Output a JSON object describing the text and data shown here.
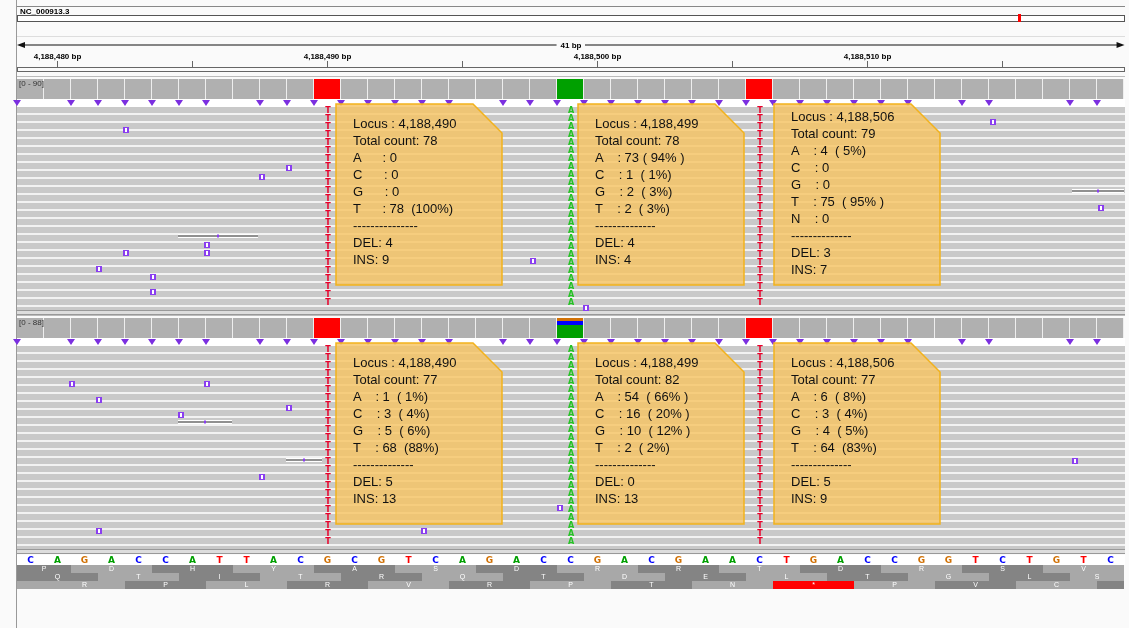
{
  "chromosome": {
    "name": "NC_000913.3"
  },
  "ruler": {
    "span": "41 bp",
    "ticks": [
      "4,188,480 bp",
      "4,188,490 bp",
      "4,188,500 bp",
      "4,188,510 bp"
    ]
  },
  "panels": [
    {
      "range": "[0 - 90]",
      "mismatches": [
        {
          "letters": "TTTTTTTTTTTTTTTTTTTTTTTTT",
          "color": "#e8002a",
          "alleles": [
            {
              "color": "#ff0000"
            }
          ]
        },
        {
          "letters": "AAAAAAAAAAAAAAAAAAAAAAAAA",
          "color": "#22c322",
          "alleles": [
            {
              "color": "#00a000"
            }
          ]
        },
        {
          "letters": "TTTTTTTTTTTTTTTTTTTTTTTTT",
          "color": "#e8002a",
          "alleles": [
            {
              "color": "#ff0000"
            }
          ]
        }
      ],
      "tooltips": [
        {
          "lines": [
            "Locus : 4,188,490",
            "Total count: 78",
            "A      : 0",
            "C      : 0",
            "G      : 0",
            "T      : 78  (100%)",
            "---------------",
            "DEL: 4",
            "INS: 9"
          ]
        },
        {
          "lines": [
            "Locus : 4,188,499",
            "Total count: 78",
            "A    : 73 ( 94% )",
            "C    : 1  ( 1%)",
            "G    : 2  ( 3%)",
            "T    : 2  ( 3%)",
            "--------------",
            "DEL: 4",
            "INS: 4"
          ]
        },
        {
          "lines": [
            "Locus : 4,188,506",
            "Total count: 79",
            "A    : 4  ( 5%)",
            "C    : 0",
            "G    : 0",
            "T    : 75  ( 95% )",
            "N    : 0",
            "--------------",
            "DEL: 3",
            "INS: 7"
          ]
        }
      ]
    },
    {
      "range": "[0 - 88]",
      "mismatches": [
        {
          "letters": "TTTTTTTTTTTTTTTTTTTTTTTTT",
          "color": "#e8002a",
          "alleles": [
            {
              "color": "#ff0000"
            }
          ]
        },
        {
          "letters": "AAAAAAAAAAAAAAAAAAAAAAAAA",
          "color": "#22c322",
          "alleles": [
            {
              "color": "#00a000"
            },
            {
              "color": "#0000ff"
            },
            {
              "color": "#d17105"
            }
          ]
        },
        {
          "letters": "TTTTTTTTTTTTTTTTTTTTTTTTT",
          "color": "#e8002a",
          "alleles": [
            {
              "color": "#ff0000"
            }
          ]
        }
      ],
      "tooltips": [
        {
          "lines": [
            "Locus : 4,188,490",
            "Total count: 77",
            "A    : 1  ( 1%)",
            "C    : 3  ( 4%)",
            "G    : 5  ( 6%)",
            "T    : 68  (88%)",
            "--------------",
            "DEL: 5",
            "INS: 13"
          ]
        },
        {
          "lines": [
            "Locus : 4,188,499",
            "Total count: 82",
            "A    : 54  ( 66% )",
            "C    : 16  ( 20% )",
            "G    : 10  ( 12% )",
            "T    : 2  ( 2%)",
            "--------------",
            "DEL: 0",
            "INS: 13"
          ]
        },
        {
          "lines": [
            "Locus : 4,188,506",
            "Total count: 77",
            "A    : 6  ( 8%)",
            "C    : 3  ( 4%)",
            "G    : 4  ( 5%)",
            "T    : 64  (83%)",
            "--------------",
            "DEL: 5",
            "INS: 9"
          ]
        }
      ]
    }
  ],
  "sequence": [
    {
      "b": "C",
      "color": "#0000ff"
    },
    {
      "b": "A",
      "color": "#00a000"
    },
    {
      "b": "G",
      "color": "#d17105"
    },
    {
      "b": "A",
      "color": "#00a000"
    },
    {
      "b": "C",
      "color": "#0000ff"
    },
    {
      "b": "C",
      "color": "#0000ff"
    },
    {
      "b": "A",
      "color": "#00a000"
    },
    {
      "b": "T",
      "color": "#ff0000"
    },
    {
      "b": "T",
      "color": "#ff0000"
    },
    {
      "b": "A",
      "color": "#00a000"
    },
    {
      "b": "C",
      "color": "#0000ff"
    },
    {
      "b": "G",
      "color": "#d17105"
    },
    {
      "b": "C",
      "color": "#0000ff"
    },
    {
      "b": "G",
      "color": "#d17105"
    },
    {
      "b": "T",
      "color": "#ff0000"
    },
    {
      "b": "C",
      "color": "#0000ff"
    },
    {
      "b": "A",
      "color": "#00a000"
    },
    {
      "b": "G",
      "color": "#d17105"
    },
    {
      "b": "A",
      "color": "#00a000"
    },
    {
      "b": "C",
      "color": "#0000ff"
    },
    {
      "b": "C",
      "color": "#0000ff"
    },
    {
      "b": "G",
      "color": "#d17105"
    },
    {
      "b": "A",
      "color": "#00a000"
    },
    {
      "b": "C",
      "color": "#0000ff"
    },
    {
      "b": "G",
      "color": "#d17105"
    },
    {
      "b": "A",
      "color": "#00a000"
    },
    {
      "b": "A",
      "color": "#00a000"
    },
    {
      "b": "C",
      "color": "#0000ff"
    },
    {
      "b": "T",
      "color": "#ff0000"
    },
    {
      "b": "G",
      "color": "#d17105"
    },
    {
      "b": "A",
      "color": "#00a000"
    },
    {
      "b": "C",
      "color": "#0000ff"
    },
    {
      "b": "C",
      "color": "#0000ff"
    },
    {
      "b": "G",
      "color": "#d17105"
    },
    {
      "b": "G",
      "color": "#d17105"
    },
    {
      "b": "T",
      "color": "#ff0000"
    },
    {
      "b": "C",
      "color": "#0000ff"
    },
    {
      "b": "T",
      "color": "#ff0000"
    },
    {
      "b": "G",
      "color": "#d17105"
    },
    {
      "b": "T",
      "color": "#ff0000"
    },
    {
      "b": "C",
      "color": "#0000ff"
    }
  ],
  "translation": [
    {
      "aa": [
        {
          "a": "P",
          "stop": false
        },
        {
          "a": "D",
          "stop": false
        },
        {
          "a": "H",
          "stop": false
        },
        {
          "a": "Y",
          "stop": false
        },
        {
          "a": "A",
          "stop": false
        },
        {
          "a": "S",
          "stop": false
        },
        {
          "a": "D",
          "stop": false
        },
        {
          "a": "R",
          "stop": false
        },
        {
          "a": "R",
          "stop": false
        },
        {
          "a": "T",
          "stop": false
        },
        {
          "a": "D",
          "stop": false
        },
        {
          "a": "R",
          "stop": false
        },
        {
          "a": "S",
          "stop": false
        },
        {
          "a": "V",
          "stop": false
        }
      ]
    },
    {
      "aa": [
        {
          "a": "Q",
          "stop": false
        },
        {
          "a": "T",
          "stop": false
        },
        {
          "a": "I",
          "stop": false
        },
        {
          "a": "T",
          "stop": false
        },
        {
          "a": "R",
          "stop": false
        },
        {
          "a": "Q",
          "stop": false
        },
        {
          "a": "T",
          "stop": false
        },
        {
          "a": "D",
          "stop": false
        },
        {
          "a": "E",
          "stop": false
        },
        {
          "a": "L",
          "stop": false
        },
        {
          "a": "T",
          "stop": false
        },
        {
          "a": "G",
          "stop": false
        },
        {
          "a": "L",
          "stop": false
        },
        {
          "a": "S",
          "stop": false
        }
      ]
    },
    {
      "aa": [
        {
          "a": "R",
          "stop": false
        },
        {
          "a": "P",
          "stop": false
        },
        {
          "a": "L",
          "stop": false
        },
        {
          "a": "R",
          "stop": false
        },
        {
          "a": "V",
          "stop": false
        },
        {
          "a": "R",
          "stop": false
        },
        {
          "a": "P",
          "stop": false
        },
        {
          "a": "T",
          "stop": false
        },
        {
          "a": "N",
          "stop": false
        },
        {
          "a": "*",
          "stop": true
        },
        {
          "a": "P",
          "stop": false
        },
        {
          "a": "V",
          "stop": false
        },
        {
          "a": "C",
          "stop": false
        }
      ]
    }
  ]
}
